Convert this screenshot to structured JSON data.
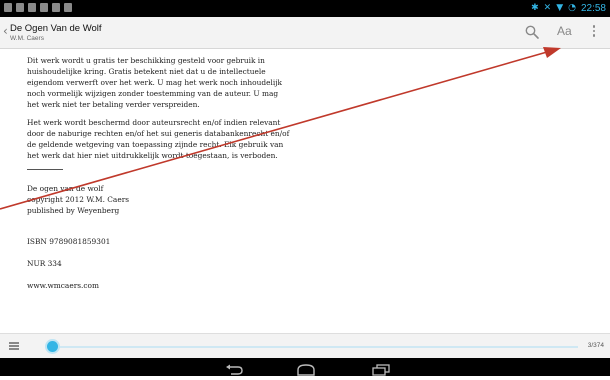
{
  "status_bar": {
    "time": "22:58"
  },
  "app_bar": {
    "back_glyph": "‹",
    "title": "De Ogen Van de Wolf",
    "author": "W.M. Caers",
    "font_button_label": "Aa",
    "icons": [
      "search-icon",
      "font-size-icon",
      "overflow-menu-icon"
    ]
  },
  "content": {
    "paragraphs": [
      "Dit werk wordt u gratis ter beschikking gesteld voor gebruik in huishoudelijke kring. Gratis betekent niet dat u de intellectuele eigendom verwerft over het werk. U mag het werk noch inhoudelijk noch vormelijk wijzigen zonder toestemming van de auteur. U mag het werk niet ter betaling verder verspreiden.",
      "Het werk wordt beschermd door auteursrecht en/of indien relevant door de naburige rechten en/of het sui generis databankenrecht en/of de geldende wetgeving van toepassing zijnde recht. Elk gebruik van het werk dat hier niet uitdrukkelijk wordt toegestaan, is verboden."
    ],
    "book_lines": [
      "De ogen van de wolf",
      "copyright 2012 W.M. Caers",
      "published by Weyenberg"
    ],
    "isbn": "ISBN 9789081859301",
    "nur": "NUR 334",
    "website": "www.wmcaers.com"
  },
  "reader_bar": {
    "page_counter": "3/374",
    "progress_fraction": 0.008
  },
  "colors": {
    "accent": "#33b5e5",
    "annotation_arrow": "#c0392b"
  }
}
